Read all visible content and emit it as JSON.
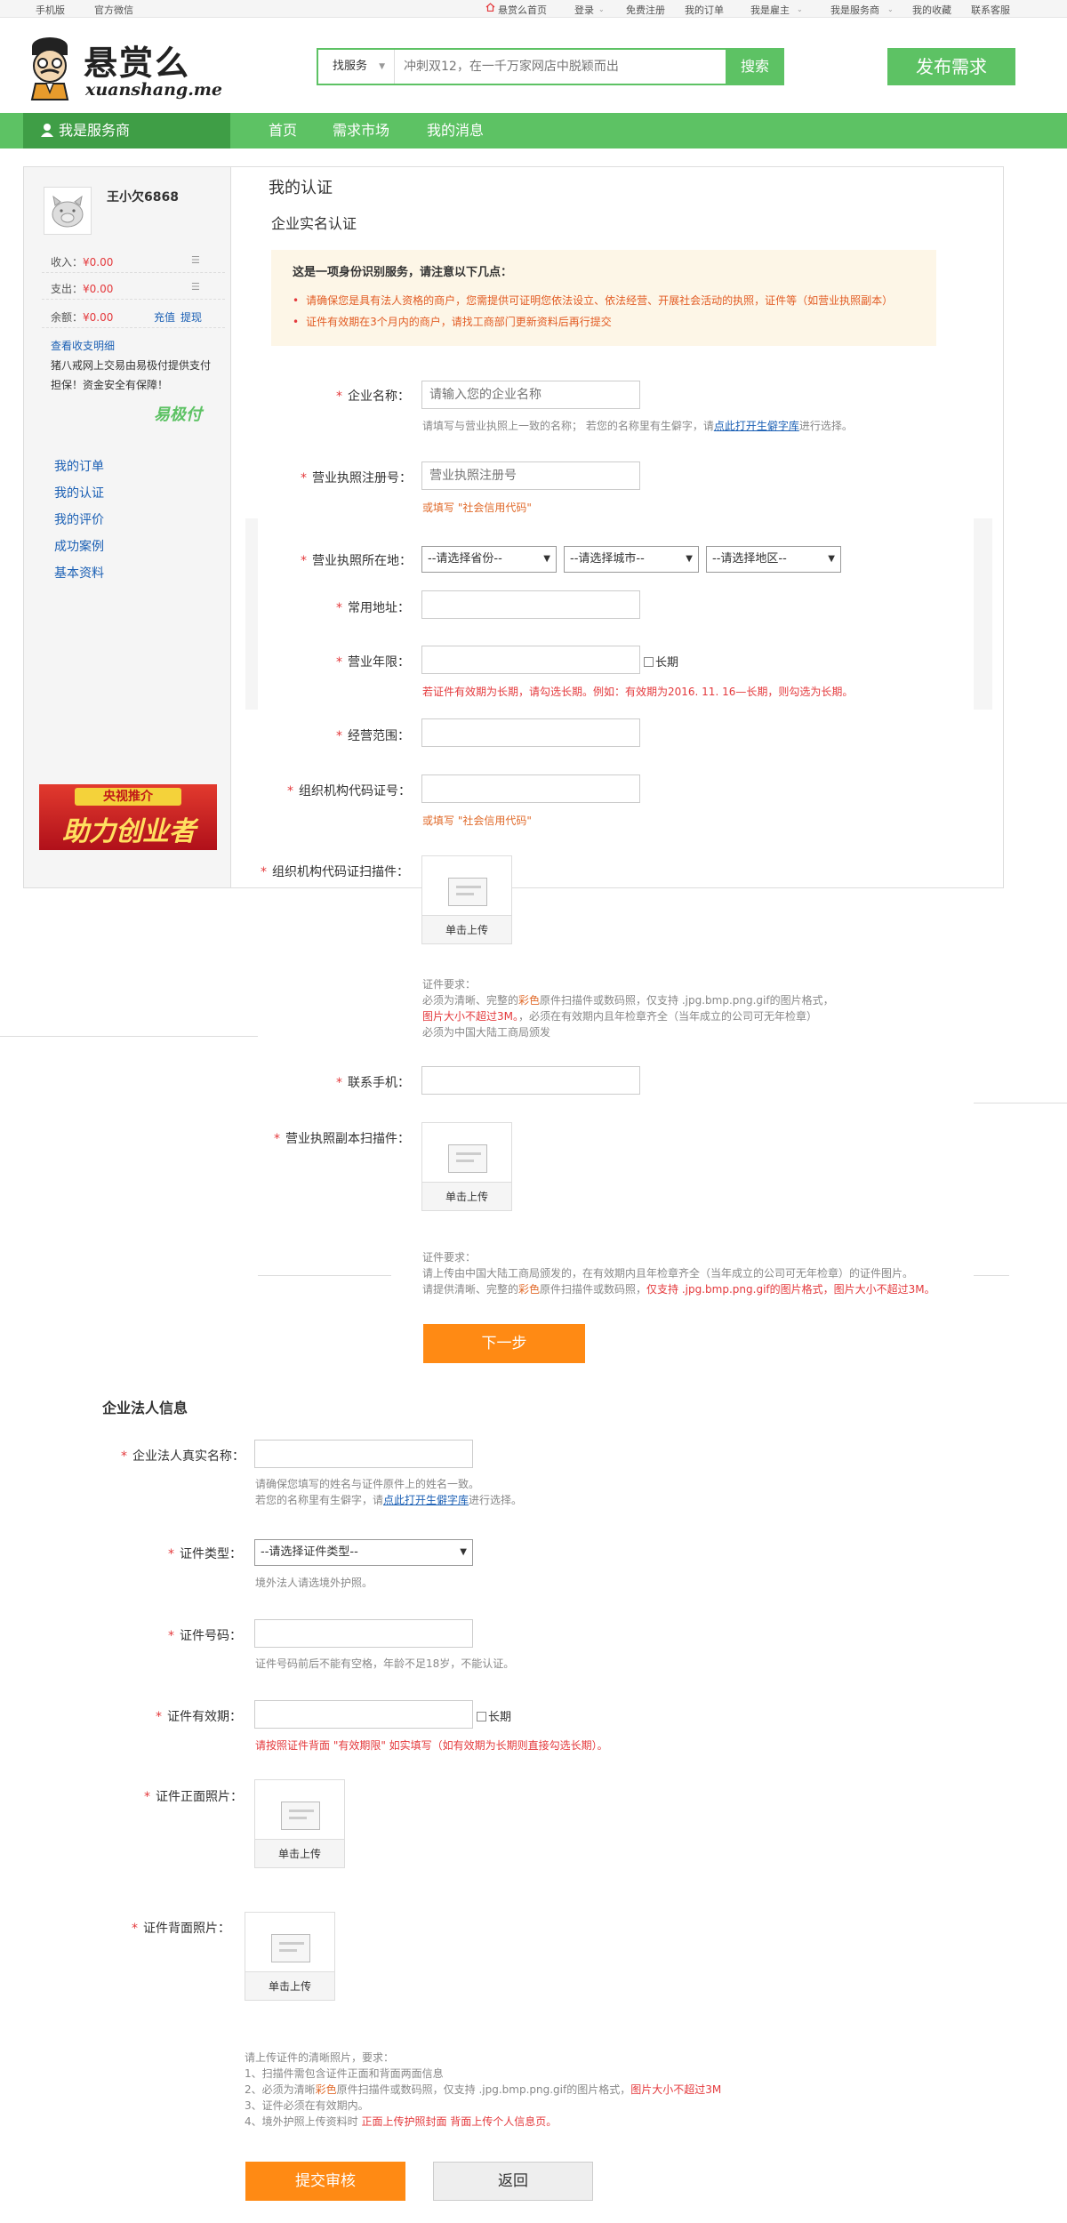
{
  "topbar": {
    "mobile": "手机版",
    "wechat": "官方微信",
    "home": "悬赏么首页",
    "login": "登录",
    "register": "免费注册",
    "my_orders": "我的订单",
    "employer": "我是雇主",
    "provider": "我是服务商",
    "favorites": "我的收藏",
    "support": "联系客服"
  },
  "logo": {
    "cn": "悬赏么",
    "en": "xuanshang.me"
  },
  "search": {
    "type": "找服务",
    "placeholder": "冲刺双12，在一千万家网店中脱颖而出",
    "button": "搜索"
  },
  "publish_button": "发布需求",
  "nav": {
    "side_title": "我是服务商",
    "items": [
      "首页",
      "需求市场",
      "我的消息"
    ]
  },
  "sidebar": {
    "username": "王小欠6868",
    "income_label": "收入：",
    "income_value": "¥0.00",
    "expense_label": "支出：",
    "expense_value": "¥0.00",
    "balance_label": "余额：",
    "balance_value": "¥0.00",
    "recharge": "充值",
    "withdraw": "提现",
    "view_details": "查看收支明细",
    "pay_note": "猪八戒网上交易由易极付提供支付担保！资金安全有保障！",
    "pay_brand": "易极付",
    "menu": [
      "我的订单",
      "我的认证",
      "我的评价",
      "成功案例",
      "基本资料"
    ],
    "banner_top": "央视推介",
    "banner_main": "助力创业者"
  },
  "content": {
    "title": "我的认证",
    "section1": "企业实名认证",
    "notice_title": "这是一项身份识别服务，请注意以下几点：",
    "notice_items": [
      "请确保您是具有法人资格的商户，您需提供可证明您依法设立、依法经营、开展社会活动的执照，证件等（如营业执照副本）",
      "证件有效期在3个月内的商户，请找工商部门更新资料后再行提交"
    ],
    "fields": {
      "company_name": {
        "label": "企业名称：",
        "placeholder": "请输入您的企业名称"
      },
      "company_hint_a": "请填写与营业执照上一致的名称； 若您的名称里有生僻字，请",
      "company_hint_link": "点此打开生僻字库",
      "company_hint_b": "进行选择。",
      "license_no": {
        "label": "营业执照注册号：",
        "placeholder": "营业执照注册号"
      },
      "license_hint": "或填写 \"社会信用代码\"",
      "license_location": {
        "label": "营业执照所在地：",
        "province": "--请选择省份--",
        "city": "--请选择城市--",
        "district": "--请选择地区--"
      },
      "address": {
        "label": "常用地址："
      },
      "term": {
        "label": "营业年限：",
        "checkbox": "长期"
      },
      "term_hint": "若证件有效期为长期，请勾选长期。例如：有效期为2016. 11. 16—长期，则勾选为长期。",
      "scope": {
        "label": "经营范围："
      },
      "org_code": {
        "label": "组织机构代码证号："
      },
      "org_code_hint": "或填写 \"社会信用代码\"",
      "org_scan": {
        "label": "组织机构代码证扫描件："
      },
      "upload_button": "单击上传",
      "org_req_title": "证件要求：",
      "org_req_1a": "必须为清晰、完整的",
      "org_req_1b": "彩色",
      "org_req_1c": "原件扫描件或数码照，仅支持 .jpg.bmp.png.gif的图片格式，",
      "org_req_2a": "图片大小不超过3M。",
      "org_req_2b": "，必须在有效期内且年检章齐全（当年成立的公司可无年检章）",
      "org_req_3": "必须为中国大陆工商局颁发",
      "phone": {
        "label": "联系手机："
      },
      "license_scan": {
        "label": "营业执照副本扫描件："
      },
      "lic_req_title": "证件要求：",
      "lic_req_1": "请上传由中国大陆工商局颁发的，在有效期内且年检章齐全（当年成立的公司可无年检章）的证件图片。",
      "lic_req_2a": "请提供清晰、完整的",
      "lic_req_2b": "彩色",
      "lic_req_2c": "原件扫描件或数码照，",
      "lic_req_2d": "仅支持 .jpg.bmp.png.gif的图片格式，图片大小不超过3M。",
      "next_button": "下一步"
    },
    "section2": "企业法人信息",
    "legal": {
      "name_label": "企业法人真实名称：",
      "name_hint_1": "请确保您填写的姓名与证件原件上的姓名一致。",
      "name_hint_2a": "若您的名称里有生僻字，请",
      "name_hint_2link": "点此打开生僻字库",
      "name_hint_2b": "进行选择。",
      "id_type_label": "证件类型：",
      "id_type_value": "--请选择证件类型--",
      "id_type_hint": "境外法人请选境外护照。",
      "id_no_label": "证件号码：",
      "id_no_hint": "证件号码前后不能有空格，年龄不足18岁，不能认证。",
      "valid_label": "证件有效期：",
      "valid_checkbox": "长期",
      "valid_hint": "请按照证件背面 \"有效期限\" 如实填写（如有效期为长期则直接勾选长期）。",
      "front_label": "证件正面照片：",
      "back_label": "证件背面照片：",
      "upload_button": "单击上传",
      "req_title": "请上传证件的清晰照片，要求：",
      "req_1": "1、扫描件需包含证件正面和背面两面信息",
      "req_2a": "2、必须为清晰",
      "req_2b": "彩色",
      "req_2c": "原件扫描件或数码照，仅支持 .jpg.bmp.png.gif的图片格式，",
      "req_2d": "图片大小不超过3M",
      "req_3": "3、证件必须在有效期内。",
      "req_4a": "4、境外护照上传资料时 ",
      "req_4b": "正面上传护照封面 背面上传个人信息页。",
      "submit": "提交审核",
      "back": "返回"
    }
  }
}
